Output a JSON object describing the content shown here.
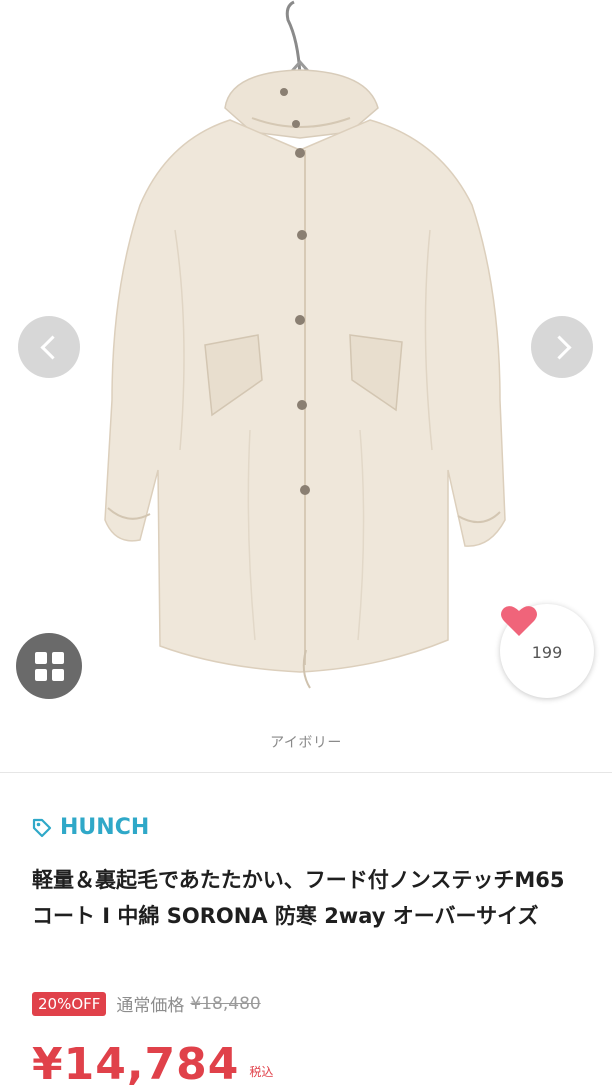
{
  "gallery": {
    "image_alt": "ivory hooded oversized coat on hanger",
    "prev_icon": "chevron-left-icon",
    "next_icon": "chevron-right-icon",
    "grid_icon": "grid-icon",
    "like": {
      "icon": "heart-icon",
      "count": "199",
      "color": "#f0647a"
    }
  },
  "color_caption": "アイボリー",
  "brand": {
    "icon": "tag-icon",
    "name": "HUNCH",
    "color": "#2fa8c8"
  },
  "product": {
    "title": "軽量＆裏起毛であたたかい、フード付ノンステッチM65コート I 中綿 SORONA 防寒 2way オーバーサイズ"
  },
  "pricing": {
    "discount_badge": "20%OFF",
    "regular_label": "通常価格",
    "regular_price": "¥18,480",
    "sale_price": "¥14,784",
    "tax_label": "税込",
    "accent": "#e0414a"
  }
}
